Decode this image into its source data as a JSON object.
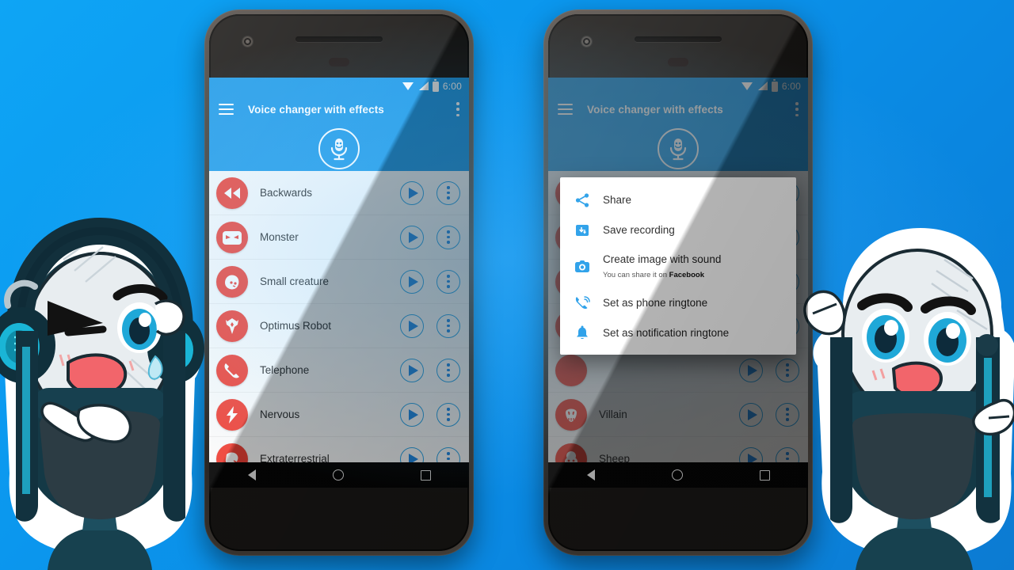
{
  "background": {
    "color_start": "#0ea5f5",
    "color_end": "#0c7bd2"
  },
  "app": {
    "title": "Voice changer with effects",
    "accent_blue": "#1e9ae8",
    "icon_red": "#ef4136"
  },
  "status_bar": {
    "time": "6:00",
    "icons": [
      "wifi-icon",
      "signal-icon",
      "battery-icon"
    ]
  },
  "nav_bar": {
    "back": "back-triangle-icon",
    "home": "home-circle-icon",
    "recents": "recents-square-icon"
  },
  "left_phone": {
    "appbar": {
      "menu_icon": "hamburger-icon",
      "title": "Voice changer with effects",
      "overflow_icon": "overflow-menu-icon",
      "logo_icon": "microphone-logo-icon"
    },
    "effects": [
      {
        "label": "Backwards",
        "icon": "rewind-icon"
      },
      {
        "label": "Monster",
        "icon": "monster-face-icon"
      },
      {
        "label": "Small creature",
        "icon": "small-creature-icon"
      },
      {
        "label": "Optimus Robot",
        "icon": "autobot-icon"
      },
      {
        "label": "Telephone",
        "icon": "telephone-handset-icon"
      },
      {
        "label": "Nervous",
        "icon": "lightning-bolt-icon"
      },
      {
        "label": "Extraterrestrial",
        "icon": "alien-head-icon"
      }
    ],
    "row_buttons": {
      "play": "play-icon",
      "more": "more-vertical-icon"
    }
  },
  "right_phone": {
    "appbar": {
      "menu_icon": "hamburger-icon",
      "title": "Voice changer with effects",
      "overflow_icon": "overflow-menu-icon",
      "logo_icon": "microphone-logo-icon"
    },
    "dialog": {
      "items": [
        {
          "title": "Share",
          "subtitle": "",
          "subtitle_bold": "",
          "icon": "share-icon"
        },
        {
          "title": "Save recording",
          "subtitle": "",
          "subtitle_bold": "",
          "icon": "save-download-icon"
        },
        {
          "title": "Create image with sound",
          "subtitle": "You can share it on ",
          "subtitle_bold": "Facebook",
          "icon": "camera-icon"
        },
        {
          "title": "Set as phone ringtone",
          "subtitle": "",
          "subtitle_bold": "",
          "icon": "phone-ring-icon"
        },
        {
          "title": "Set as notification ringtone",
          "subtitle": "",
          "subtitle_bold": "",
          "icon": "bell-icon"
        }
      ]
    },
    "effects": [
      {
        "label": "Villain",
        "icon": "villain-skull-icon"
      },
      {
        "label": "Sheep",
        "icon": "sheep-face-icon"
      }
    ],
    "row_buttons": {
      "play": "play-icon",
      "more": "more-vertical-icon"
    }
  },
  "mascots": {
    "left": "robot-microphone-mascot-headphones",
    "right": "robot-microphone-mascot-waving"
  }
}
